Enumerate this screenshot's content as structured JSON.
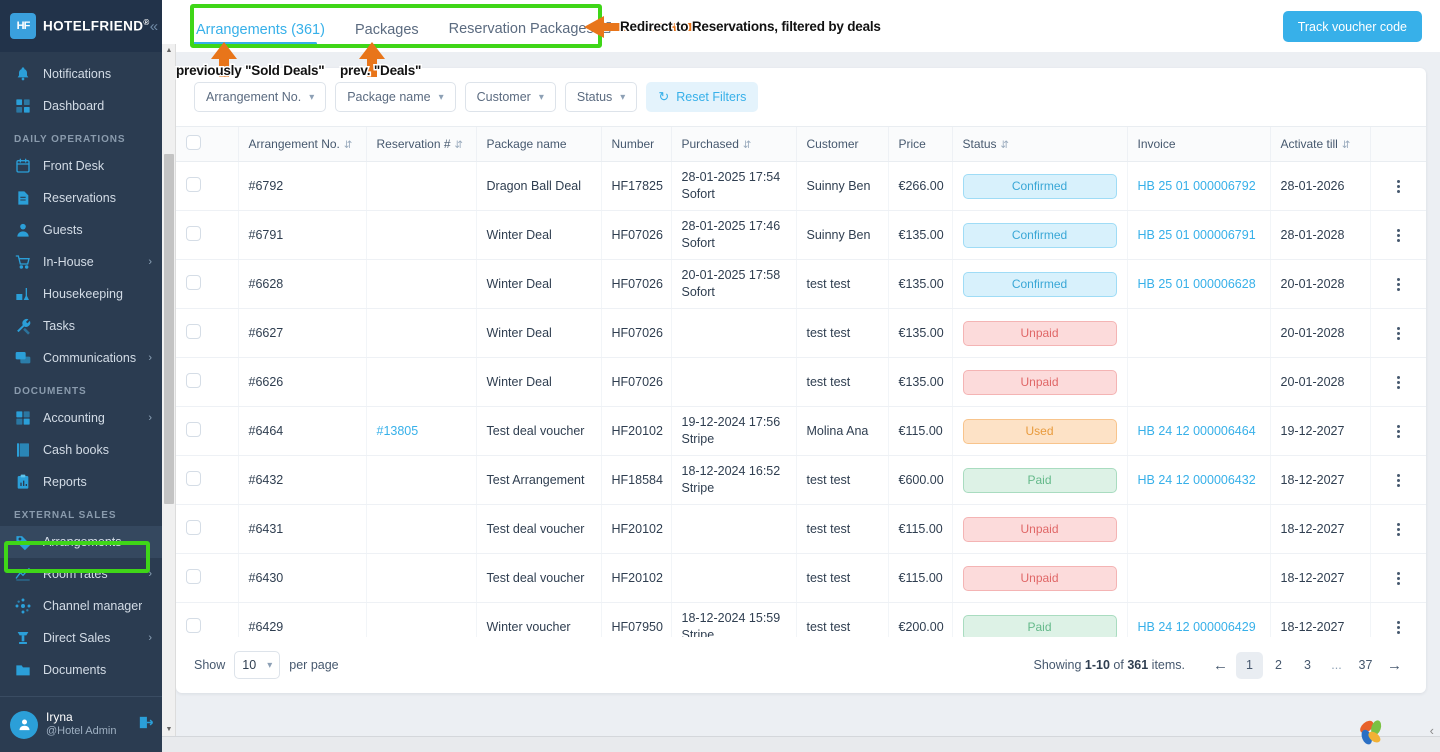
{
  "brand": {
    "name": "HOTELFRIEND",
    "reg": "®",
    "logo_text": "HF",
    "collapse_icon": "chevron-double-left-icon"
  },
  "sidebar": {
    "items": [
      {
        "label": "Notifications",
        "icon": "bell-icon",
        "caret": "",
        "section": "",
        "active": false
      },
      {
        "label": "Dashboard",
        "icon": "grid-icon",
        "caret": "",
        "section": "",
        "active": false
      },
      {
        "label": "DAILY OPERATIONS",
        "icon": "",
        "caret": "",
        "section": "heading",
        "active": false
      },
      {
        "label": "Front Desk",
        "icon": "calendar-icon",
        "caret": "",
        "section": "",
        "active": false
      },
      {
        "label": "Reservations",
        "icon": "document-icon",
        "caret": "",
        "section": "",
        "active": false
      },
      {
        "label": "Guests",
        "icon": "user-icon",
        "caret": "",
        "section": "",
        "active": false
      },
      {
        "label": "In-House",
        "icon": "cart-icon",
        "caret": "›",
        "section": "",
        "active": false
      },
      {
        "label": "Housekeeping",
        "icon": "broom-icon",
        "caret": "",
        "section": "",
        "active": false
      },
      {
        "label": "Tasks",
        "icon": "wrench-icon",
        "caret": "",
        "section": "",
        "active": false
      },
      {
        "label": "Communications",
        "icon": "chat-icon",
        "caret": "›",
        "section": "",
        "active": false
      },
      {
        "label": "DOCUMENTS",
        "icon": "",
        "caret": "",
        "section": "heading",
        "active": false
      },
      {
        "label": "Accounting",
        "icon": "accounting-icon",
        "caret": "›",
        "section": "",
        "active": false
      },
      {
        "label": "Cash books",
        "icon": "book-icon",
        "caret": "",
        "section": "",
        "active": false
      },
      {
        "label": "Reports",
        "icon": "clipboard-icon",
        "caret": "",
        "section": "",
        "active": false
      },
      {
        "label": "EXTERNAL SALES",
        "icon": "",
        "caret": "",
        "section": "heading",
        "active": false
      },
      {
        "label": "Arrangements",
        "icon": "tag-icon",
        "caret": "",
        "section": "",
        "active": true
      },
      {
        "label": "Room rates",
        "icon": "chart-icon",
        "caret": "›",
        "section": "",
        "active": false
      },
      {
        "label": "Channel manager",
        "icon": "network-icon",
        "caret": "",
        "section": "",
        "active": false
      },
      {
        "label": "Direct Sales",
        "icon": "megaphone-icon",
        "caret": "›",
        "section": "",
        "active": false
      },
      {
        "label": "Documents",
        "icon": "folder-icon",
        "caret": "",
        "section": "",
        "active": false
      }
    ],
    "user": {
      "name": "Iryna",
      "role": "@Hotel Admin",
      "logout_icon": "logout-icon"
    }
  },
  "topbar": {
    "tabs": [
      {
        "label": "Arrangements (361)",
        "active": true,
        "external": false
      },
      {
        "label": "Packages",
        "active": false,
        "external": false
      },
      {
        "label": "Reservation Packages",
        "active": false,
        "external": true
      }
    ],
    "track_button": "Track voucher code"
  },
  "filters": {
    "chips": [
      {
        "label": "Arrangement No."
      },
      {
        "label": "Package name"
      },
      {
        "label": "Customer"
      },
      {
        "label": "Status"
      }
    ],
    "reset_label": "Reset Filters",
    "reset_icon": "refresh-icon"
  },
  "table": {
    "columns": [
      {
        "label": "",
        "sortable": false
      },
      {
        "label": "Arrangement No.",
        "sortable": true
      },
      {
        "label": "Reservation #",
        "sortable": true
      },
      {
        "label": "Package name",
        "sortable": false
      },
      {
        "label": "Number",
        "sortable": false
      },
      {
        "label": "Purchased",
        "sortable": true
      },
      {
        "label": "Customer",
        "sortable": false
      },
      {
        "label": "Price",
        "sortable": false
      },
      {
        "label": "Status",
        "sortable": true
      },
      {
        "label": "Invoice",
        "sortable": false
      },
      {
        "label": "Activate till",
        "sortable": true
      },
      {
        "label": "",
        "sortable": false
      }
    ],
    "rows": [
      {
        "arrangement_no": "#6792",
        "reservation": "",
        "package_name": "Dragon Ball Deal",
        "number": "HF17825",
        "purchased_date": "28-01-2025 17:54",
        "purchased_method": "Sofort",
        "customer": "Suinny Ben",
        "price": "€266.00",
        "status": "Confirmed",
        "status_class": "b-confirmed",
        "invoice": "HB 25 01 000006792",
        "activate_till": "28-01-2026"
      },
      {
        "arrangement_no": "#6791",
        "reservation": "",
        "package_name": "Winter Deal",
        "number": "HF07026",
        "purchased_date": "28-01-2025 17:46",
        "purchased_method": "Sofort",
        "customer": "Suinny Ben",
        "price": "€135.00",
        "status": "Confirmed",
        "status_class": "b-confirmed",
        "invoice": "HB 25 01 000006791",
        "activate_till": "28-01-2028"
      },
      {
        "arrangement_no": "#6628",
        "reservation": "",
        "package_name": "Winter Deal",
        "number": "HF07026",
        "purchased_date": "20-01-2025 17:58",
        "purchased_method": "Sofort",
        "customer": "test test",
        "price": "€135.00",
        "status": "Confirmed",
        "status_class": "b-confirmed",
        "invoice": "HB 25 01 000006628",
        "activate_till": "20-01-2028"
      },
      {
        "arrangement_no": "#6627",
        "reservation": "",
        "package_name": "Winter Deal",
        "number": "HF07026",
        "purchased_date": "",
        "purchased_method": "",
        "customer": "test test",
        "price": "€135.00",
        "status": "Unpaid",
        "status_class": "b-unpaid",
        "invoice": "",
        "activate_till": "20-01-2028"
      },
      {
        "arrangement_no": "#6626",
        "reservation": "",
        "package_name": "Winter Deal",
        "number": "HF07026",
        "purchased_date": "",
        "purchased_method": "",
        "customer": "test test",
        "price": "€135.00",
        "status": "Unpaid",
        "status_class": "b-unpaid",
        "invoice": "",
        "activate_till": "20-01-2028"
      },
      {
        "arrangement_no": "#6464",
        "reservation": "#13805",
        "package_name": "Test deal voucher",
        "number": "HF20102",
        "purchased_date": "19-12-2024 17:56",
        "purchased_method": "Stripe",
        "customer": "Molina Ana",
        "price": "€115.00",
        "status": "Used",
        "status_class": "b-used",
        "invoice": "HB 24 12 000006464",
        "activate_till": "19-12-2027"
      },
      {
        "arrangement_no": "#6432",
        "reservation": "",
        "package_name": "Test Arrangement",
        "number": "HF18584",
        "purchased_date": "18-12-2024 16:52",
        "purchased_method": "Stripe",
        "customer": "test test",
        "price": "€600.00",
        "status": "Paid",
        "status_class": "b-paid",
        "invoice": "HB 24 12 000006432",
        "activate_till": "18-12-2027"
      },
      {
        "arrangement_no": "#6431",
        "reservation": "",
        "package_name": "Test deal voucher",
        "number": "HF20102",
        "purchased_date": "",
        "purchased_method": "",
        "customer": "test test",
        "price": "€115.00",
        "status": "Unpaid",
        "status_class": "b-unpaid",
        "invoice": "",
        "activate_till": "18-12-2027"
      },
      {
        "arrangement_no": "#6430",
        "reservation": "",
        "package_name": "Test deal voucher",
        "number": "HF20102",
        "purchased_date": "",
        "purchased_method": "",
        "customer": "test test",
        "price": "€115.00",
        "status": "Unpaid",
        "status_class": "b-unpaid",
        "invoice": "",
        "activate_till": "18-12-2027"
      },
      {
        "arrangement_no": "#6429",
        "reservation": "",
        "package_name": "Winter voucher",
        "number": "HF07950",
        "purchased_date": "18-12-2024 15:59",
        "purchased_method": "Stripe",
        "customer": "test test",
        "price": "€200.00",
        "status": "Paid",
        "status_class": "b-paid",
        "invoice": "HB 24 12 000006429",
        "activate_till": "18-12-2027"
      }
    ]
  },
  "footer": {
    "show_label": "Show",
    "per_page_value": "10",
    "per_page_label": "per page",
    "showing_prefix": "Showing ",
    "showing_range": "1-10",
    "showing_of": " of ",
    "showing_total": "361",
    "showing_suffix": " items.",
    "prev_icon": "arrow-left-icon",
    "next_icon": "arrow-right-icon",
    "pages": [
      "1",
      "2",
      "3",
      "...",
      "37"
    ],
    "active_page": "1"
  },
  "annotations": [
    {
      "text": "previously \"Sold Deals\""
    },
    {
      "text": "prev. \"Deals\""
    },
    {
      "text": "Redirect to Reservations, filtered by deals"
    }
  ],
  "colors": {
    "accent": "#37b0e9",
    "sidebar_bg": "#2b3c51",
    "annotation_green": "#3fd618",
    "annotation_orange": "#e8751a"
  }
}
